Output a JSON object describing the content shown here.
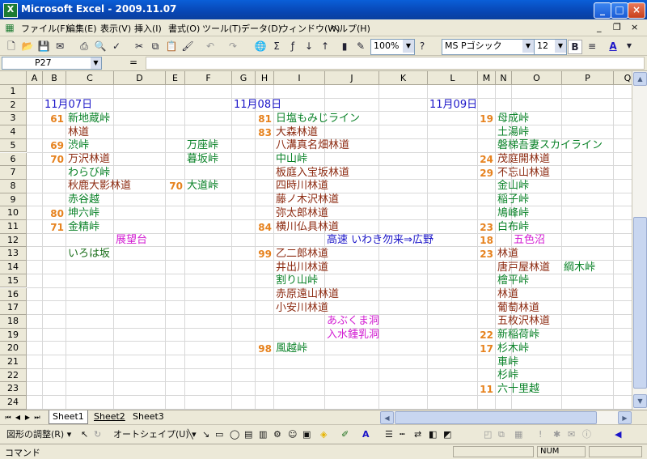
{
  "window": {
    "title": "Microsoft Excel - 2009.11.07",
    "app_icon_label": "X",
    "minimize": "_",
    "maximize": "□",
    "close": "×",
    "doc_minimize": "_",
    "doc_restore": "❐",
    "doc_close": "×"
  },
  "menu": {
    "items": [
      "ファイル(F)",
      "編集(E)",
      "表示(V)",
      "挿入(I)",
      "書式(O)",
      "ツール(T)",
      "データ(D)",
      "ウィンドウ(W)",
      "ヘルプ(H)"
    ]
  },
  "toolbar": {
    "zoom": "100%",
    "font_name": "MS Pゴシック",
    "font_size": "12",
    "bold": "B"
  },
  "formula_bar": {
    "name_box": "P27",
    "equals": "=",
    "content": ""
  },
  "grid": {
    "columns": [
      "A",
      "B",
      "C",
      "D",
      "E",
      "F",
      "G",
      "H",
      "I",
      "J",
      "K",
      "L",
      "M",
      "N",
      "O",
      "P",
      "Q"
    ],
    "rows": [
      "1",
      "2",
      "3",
      "4",
      "5",
      "6",
      "7",
      "8",
      "9",
      "10",
      "11",
      "12",
      "13",
      "14",
      "15",
      "16",
      "17",
      "18",
      "19",
      "20",
      "21",
      "22",
      "23",
      "24"
    ],
    "colors": {
      "blue": "#1a14c8",
      "green": "#0a8228",
      "brown": "#8c2a10",
      "magenta": "#d21ed2",
      "orange": "#e6821e",
      "darkgreen": "#1a6e1a"
    },
    "cells": [
      {
        "t": "11月07日",
        "r": 2,
        "c": "B",
        "k": "blue"
      },
      {
        "t": "61",
        "r": 3,
        "c": "B",
        "k": "orange"
      },
      {
        "t": "新地蔵峠",
        "r": 3,
        "c": "C",
        "k": "green"
      },
      {
        "t": "林道",
        "r": 4,
        "c": "C",
        "k": "brown"
      },
      {
        "t": "69",
        "r": 5,
        "c": "B",
        "k": "orange"
      },
      {
        "t": "渋峠",
        "r": 5,
        "c": "C",
        "k": "green"
      },
      {
        "t": "万座峠",
        "r": 5,
        "c": "F",
        "k": "green"
      },
      {
        "t": "70",
        "r": 6,
        "c": "B",
        "k": "orange"
      },
      {
        "t": "万沢林道",
        "r": 6,
        "c": "C",
        "k": "brown"
      },
      {
        "t": "暮坂峠",
        "r": 6,
        "c": "F",
        "k": "green"
      },
      {
        "t": "わらび峠",
        "r": 7,
        "c": "C",
        "k": "green"
      },
      {
        "t": "秋鹿大影林道",
        "r": 8,
        "c": "C",
        "k": "brown"
      },
      {
        "t": "70",
        "r": 8,
        "c": "E",
        "k": "orange"
      },
      {
        "t": "大道峠",
        "r": 8,
        "c": "F",
        "k": "green"
      },
      {
        "t": "赤谷越",
        "r": 9,
        "c": "C",
        "k": "green"
      },
      {
        "t": "80",
        "r": 10,
        "c": "B",
        "k": "orange"
      },
      {
        "t": "坤六峠",
        "r": 10,
        "c": "C",
        "k": "green"
      },
      {
        "t": "71",
        "r": 11,
        "c": "B",
        "k": "orange"
      },
      {
        "t": "金精峠",
        "r": 11,
        "c": "C",
        "k": "green"
      },
      {
        "t": "展望台",
        "r": 12,
        "c": "D",
        "k": "magenta"
      },
      {
        "t": "いろは坂",
        "r": 13,
        "c": "C",
        "k": "darkgreen"
      },
      {
        "t": "11月08日",
        "r": 2,
        "c": "G",
        "k": "blue"
      },
      {
        "t": "81",
        "r": 3,
        "c": "H",
        "k": "orange"
      },
      {
        "t": "日塩もみじライン",
        "r": 3,
        "c": "I",
        "k": "green"
      },
      {
        "t": "83",
        "r": 4,
        "c": "H",
        "k": "orange"
      },
      {
        "t": "大森林道",
        "r": 4,
        "c": "I",
        "k": "brown"
      },
      {
        "t": "八溝真名畑林道",
        "r": 5,
        "c": "I",
        "k": "brown"
      },
      {
        "t": "中山峠",
        "r": 6,
        "c": "I",
        "k": "green"
      },
      {
        "t": "板庭入宝坂林道",
        "r": 7,
        "c": "I",
        "k": "brown"
      },
      {
        "t": "四時川林道",
        "r": 8,
        "c": "I",
        "k": "brown"
      },
      {
        "t": "藤ノ木沢林道",
        "r": 9,
        "c": "I",
        "k": "brown"
      },
      {
        "t": "弥太郎林道",
        "r": 10,
        "c": "I",
        "k": "brown"
      },
      {
        "t": "84",
        "r": 11,
        "c": "H",
        "k": "orange"
      },
      {
        "t": "横川仏具林道",
        "r": 11,
        "c": "I",
        "k": "brown"
      },
      {
        "t": "高速 いわき勿来⇒広野",
        "r": 12,
        "c": "J",
        "k": "blue"
      },
      {
        "t": "99",
        "r": 13,
        "c": "H",
        "k": "orange"
      },
      {
        "t": "乙二郎林道",
        "r": 13,
        "c": "I",
        "k": "brown"
      },
      {
        "t": "井出川林道",
        "r": 14,
        "c": "I",
        "k": "brown"
      },
      {
        "t": "割り山峠",
        "r": 15,
        "c": "I",
        "k": "green"
      },
      {
        "t": "赤原遠山林道",
        "r": 16,
        "c": "I",
        "k": "brown"
      },
      {
        "t": "小安川林道",
        "r": 17,
        "c": "I",
        "k": "brown"
      },
      {
        "t": "あぶくま洞",
        "r": 18,
        "c": "J",
        "k": "magenta"
      },
      {
        "t": "入水鍾乳洞",
        "r": 19,
        "c": "J",
        "k": "magenta"
      },
      {
        "t": "98",
        "r": 20,
        "c": "H",
        "k": "orange"
      },
      {
        "t": "風越峠",
        "r": 20,
        "c": "I",
        "k": "green"
      },
      {
        "t": "11月09日",
        "r": 2,
        "c": "L",
        "k": "blue"
      },
      {
        "t": "19",
        "r": 3,
        "c": "M",
        "k": "orange"
      },
      {
        "t": "母成峠",
        "r": 3,
        "c": "N",
        "k": "green"
      },
      {
        "t": "土湯峠",
        "r": 4,
        "c": "N",
        "k": "green"
      },
      {
        "t": "磐梯吾妻スカイライン",
        "r": 5,
        "c": "N",
        "k": "green"
      },
      {
        "t": "24",
        "r": 6,
        "c": "M",
        "k": "orange"
      },
      {
        "t": "茂庭開林道",
        "r": 6,
        "c": "N",
        "k": "brown"
      },
      {
        "t": "29",
        "r": 7,
        "c": "M",
        "k": "orange"
      },
      {
        "t": "不忘山林道",
        "r": 7,
        "c": "N",
        "k": "brown"
      },
      {
        "t": "金山峠",
        "r": 8,
        "c": "N",
        "k": "green"
      },
      {
        "t": "稲子峠",
        "r": 9,
        "c": "N",
        "k": "green"
      },
      {
        "t": "鳩峰峠",
        "r": 10,
        "c": "N",
        "k": "green"
      },
      {
        "t": "23",
        "r": 11,
        "c": "M",
        "k": "orange"
      },
      {
        "t": "白布峠",
        "r": 11,
        "c": "N",
        "k": "green"
      },
      {
        "t": "18",
        "r": 12,
        "c": "M",
        "k": "orange"
      },
      {
        "t": "五色沼",
        "r": 12,
        "c": "O",
        "k": "magenta"
      },
      {
        "t": "23",
        "r": 13,
        "c": "M",
        "k": "orange"
      },
      {
        "t": "林道",
        "r": 13,
        "c": "N",
        "k": "brown"
      },
      {
        "t": "唐戸屋林道",
        "r": 14,
        "c": "N",
        "k": "brown"
      },
      {
        "t": "綱木峠",
        "r": 14,
        "c": "P",
        "k": "green"
      },
      {
        "t": "檜平峠",
        "r": 15,
        "c": "N",
        "k": "green"
      },
      {
        "t": "林道",
        "r": 16,
        "c": "N",
        "k": "brown"
      },
      {
        "t": "葡萄林道",
        "r": 17,
        "c": "N",
        "k": "brown"
      },
      {
        "t": "五枚沢林道",
        "r": 18,
        "c": "N",
        "k": "brown"
      },
      {
        "t": "22",
        "r": 19,
        "c": "M",
        "k": "orange"
      },
      {
        "t": "新稲荷峠",
        "r": 19,
        "c": "N",
        "k": "green"
      },
      {
        "t": "17",
        "r": 20,
        "c": "M",
        "k": "orange"
      },
      {
        "t": "杉木峠",
        "r": 20,
        "c": "N",
        "k": "green"
      },
      {
        "t": "車峠",
        "r": 21,
        "c": "N",
        "k": "green"
      },
      {
        "t": "杉峠",
        "r": 22,
        "c": "N",
        "k": "green"
      },
      {
        "t": "11",
        "r": 23,
        "c": "M",
        "k": "orange"
      },
      {
        "t": "六十里越",
        "r": 23,
        "c": "N",
        "k": "green"
      }
    ]
  },
  "sheets": {
    "tabs": [
      "Sheet1",
      "Sheet2",
      "Sheet3"
    ],
    "active": "Sheet1"
  },
  "drawing_toolbar": {
    "draw_menu": "図形の調整(R) ▾",
    "autoshape_menu": "オートシェイプ(U) ▾"
  },
  "status": {
    "mode": "コマンド",
    "num": "NUM"
  }
}
